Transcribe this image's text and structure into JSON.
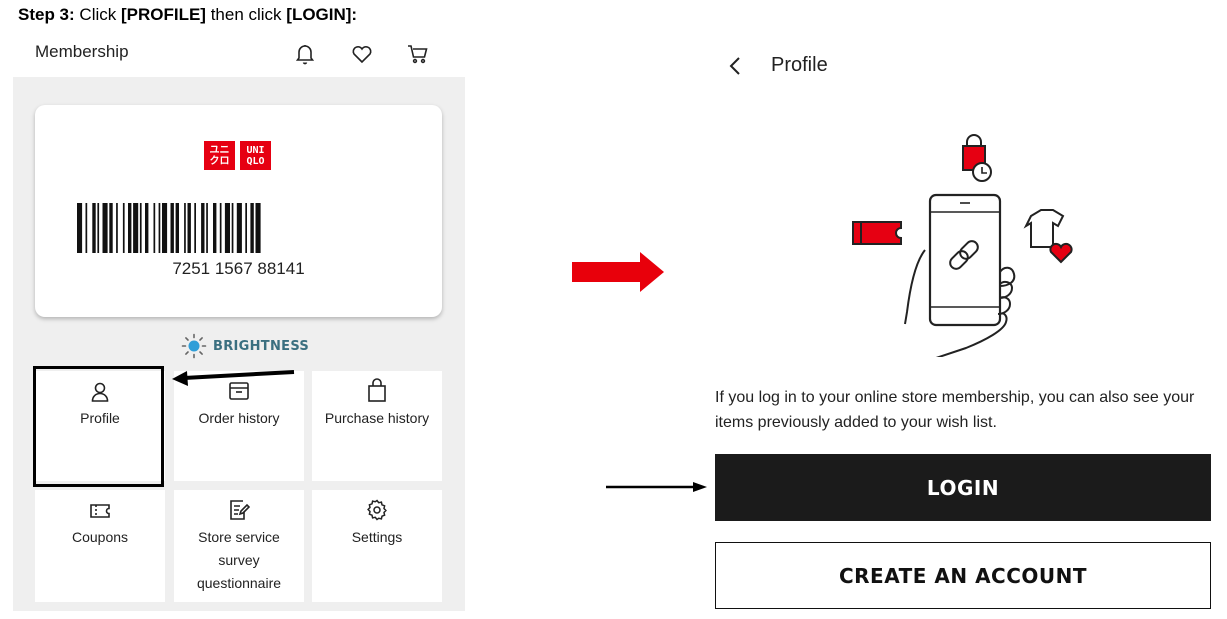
{
  "step": {
    "prefix": "Step 3:",
    "text1": " Click ",
    "profile": "[PROFILE]",
    "text2": " then click ",
    "login": "[LOGIN]:"
  },
  "left": {
    "header_title": "Membership",
    "header_icons": [
      "bell-icon",
      "heart-icon",
      "cart-icon"
    ],
    "logo_left": "ユニ クロ",
    "logo_right": "UNI QLO",
    "barcode_number": "7251 1567 88141",
    "brightness_label": "BRIGHTNESS",
    "tiles": [
      {
        "label": "Profile",
        "icon": "person-icon"
      },
      {
        "label": "Order history",
        "icon": "box-icon"
      },
      {
        "label": "Purchase history",
        "icon": "bag-icon"
      },
      {
        "label": "Coupons",
        "icon": "ticket-icon"
      },
      {
        "label": "Store service survey questionnaire",
        "icon": "survey-icon"
      },
      {
        "label": "Settings",
        "icon": "gear-icon"
      }
    ]
  },
  "right": {
    "title": "Profile",
    "info": "If you log in to your online store membership, you can also see your items previously added to your wish list.",
    "login_label": "LOGIN",
    "create_label": "CREATE AN ACCOUNT"
  },
  "colors": {
    "brand_red": "#e60012",
    "arrow_red": "#e8000b",
    "brightness_teal": "#3a6f80",
    "login_bg": "#1b1b1b"
  }
}
